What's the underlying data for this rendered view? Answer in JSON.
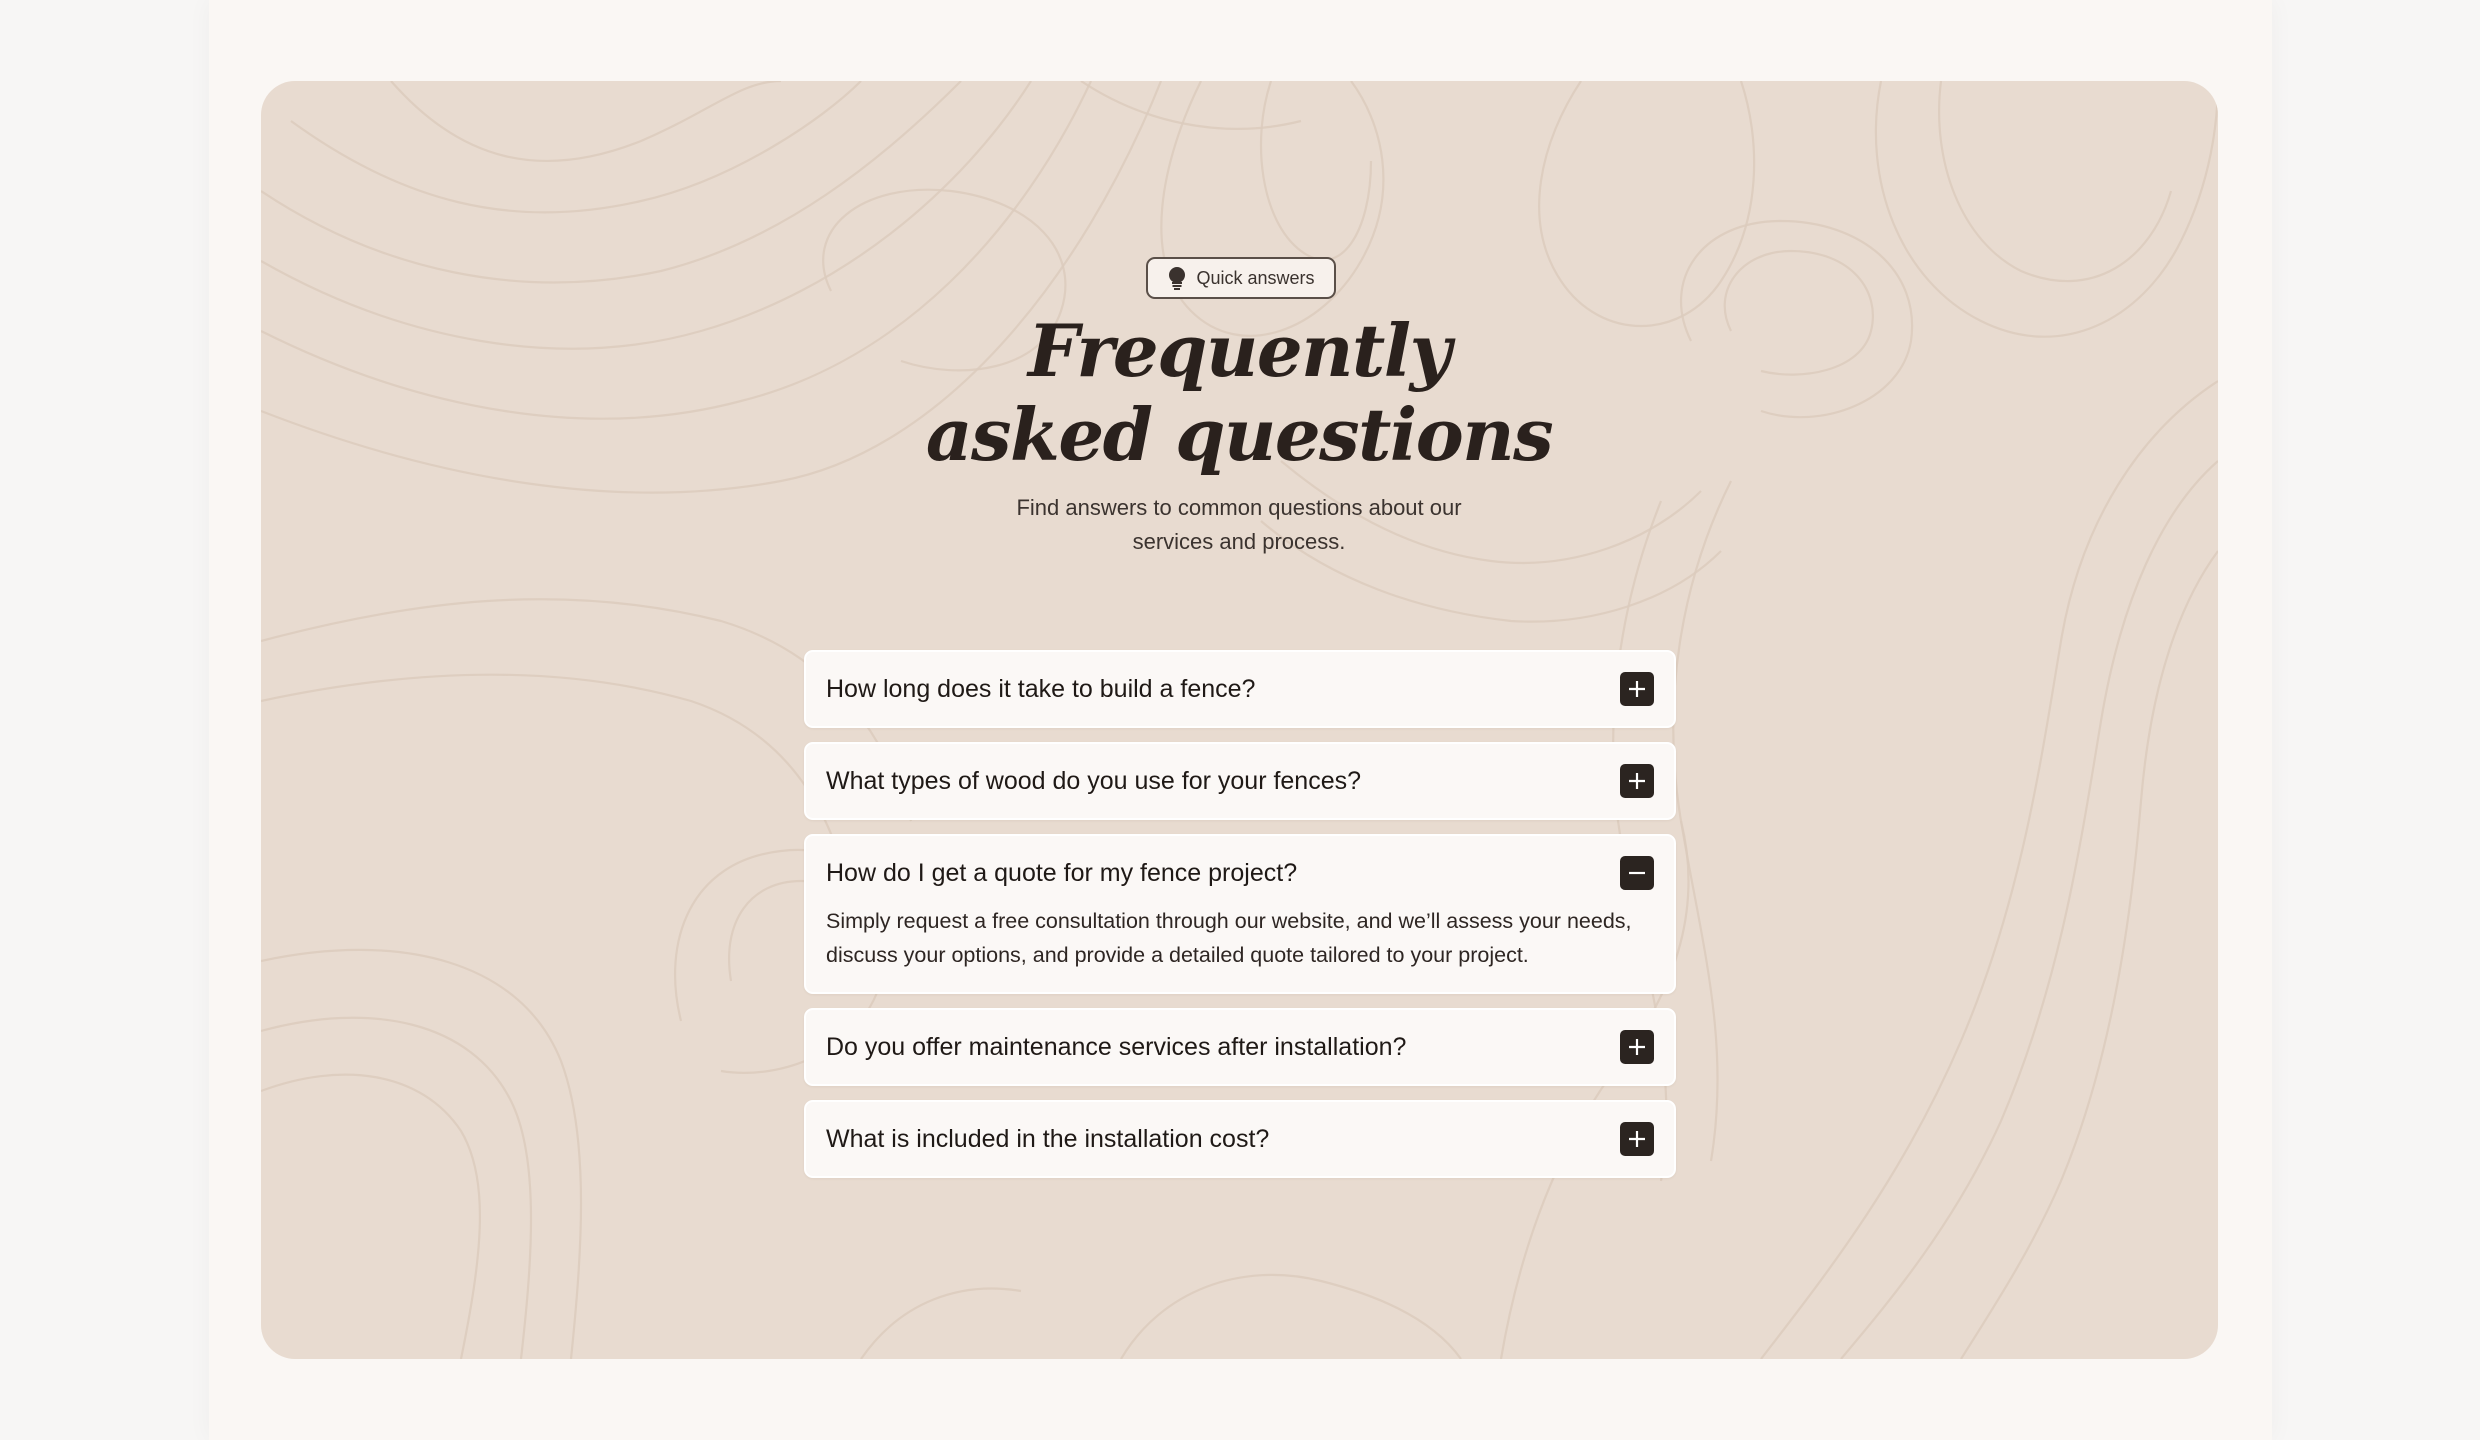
{
  "badge": {
    "icon": "lightbulb-icon",
    "label": "Quick answers"
  },
  "heading": {
    "line1": "Frequently",
    "line2": "asked questions"
  },
  "subtitle": {
    "line1": "Find answers to common questions about our",
    "line2": "services and process."
  },
  "faq": {
    "items": [
      {
        "question": "How long does it take to build a fence?",
        "expanded": false,
        "toggle_icon": "plus-icon"
      },
      {
        "question": "What types of wood do you use for your fences?",
        "expanded": false,
        "toggle_icon": "plus-icon"
      },
      {
        "question": "How do I get a quote for my fence project?",
        "expanded": true,
        "toggle_icon": "minus-icon",
        "answer": "Simply request a free consultation through our website, and we’ll assess your needs, discuss your options, and provide a detailed quote tailored to your project."
      },
      {
        "question": "Do you offer maintenance services after installation?",
        "expanded": false,
        "toggle_icon": "plus-icon"
      },
      {
        "question": "What is included in the installation cost?",
        "expanded": false,
        "toggle_icon": "plus-icon"
      }
    ]
  },
  "colors": {
    "card_background": "#e8dbd0",
    "accent": "#2b2420",
    "page_background": "#faf7f4"
  }
}
